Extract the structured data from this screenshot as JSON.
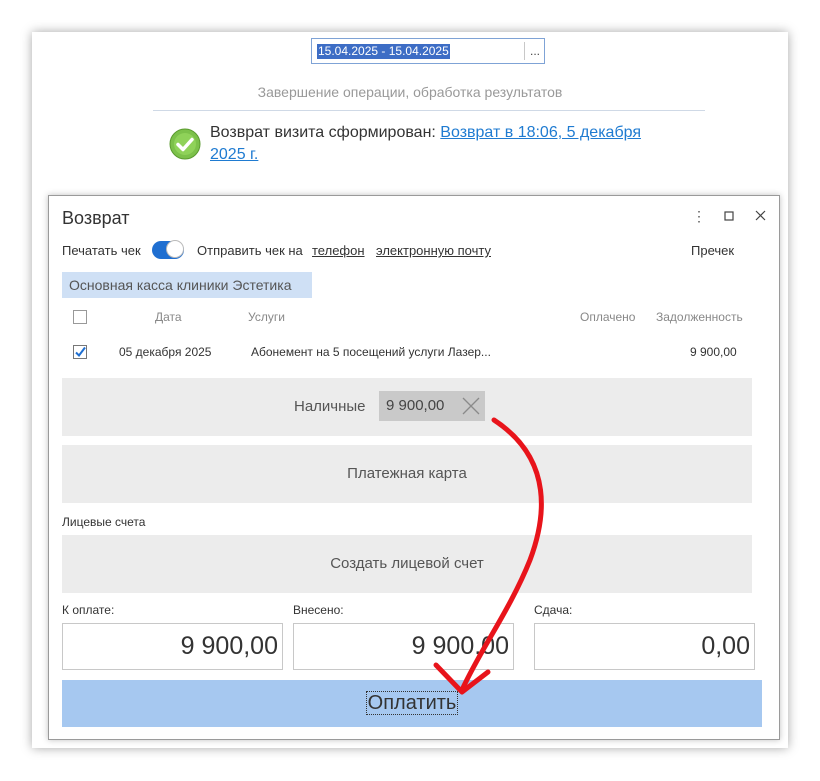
{
  "date_range": "15.04.2025 - 15.04.2025",
  "date_picker_label": "...",
  "status_text": "Завершение операции, обработка результатов",
  "message": {
    "prefix": "Возврат визита сформирован: ",
    "link_text": "Возврат  в 18:06, 5 декабря 2025 г."
  },
  "dialog": {
    "title": "Возврат",
    "print_check_label": "Печатать чек",
    "print_check_on": true,
    "send_check_label": "Отправить чек на",
    "phone_link": "телефон",
    "email_link": "электронную почту",
    "precheck_label": "Пречек",
    "cash_register": "Основная касса клиники Эстетика",
    "table": {
      "headers": [
        "Дата",
        "Услуги",
        "Оплачено",
        "Задолженность"
      ],
      "rows": [
        {
          "checked": true,
          "date": "05 декабря 2025",
          "service": "Абонемент на 5 посещений услуги Лазер...",
          "paid": "",
          "debt": "9 900,00"
        }
      ]
    },
    "cash_label": "Наличные",
    "cash_value": "9 900,00",
    "card_label": "Платежная карта",
    "accounts_label": "Лицевые счета",
    "create_account_label": "Создать лицевой счет",
    "to_pay_label": "К оплате:",
    "to_pay_value": "9 900,00",
    "paid_in_label": "Внесено:",
    "paid_in_value": "9 900,00",
    "change_label": "Сдача:",
    "change_value": "0,00",
    "pay_button": "Оплатить"
  },
  "colors": {
    "accent": "#1f6fd1",
    "link": "#1f7bd1",
    "pay_button": "#a6c8f0",
    "annotation_arrow": "#e8141b"
  }
}
